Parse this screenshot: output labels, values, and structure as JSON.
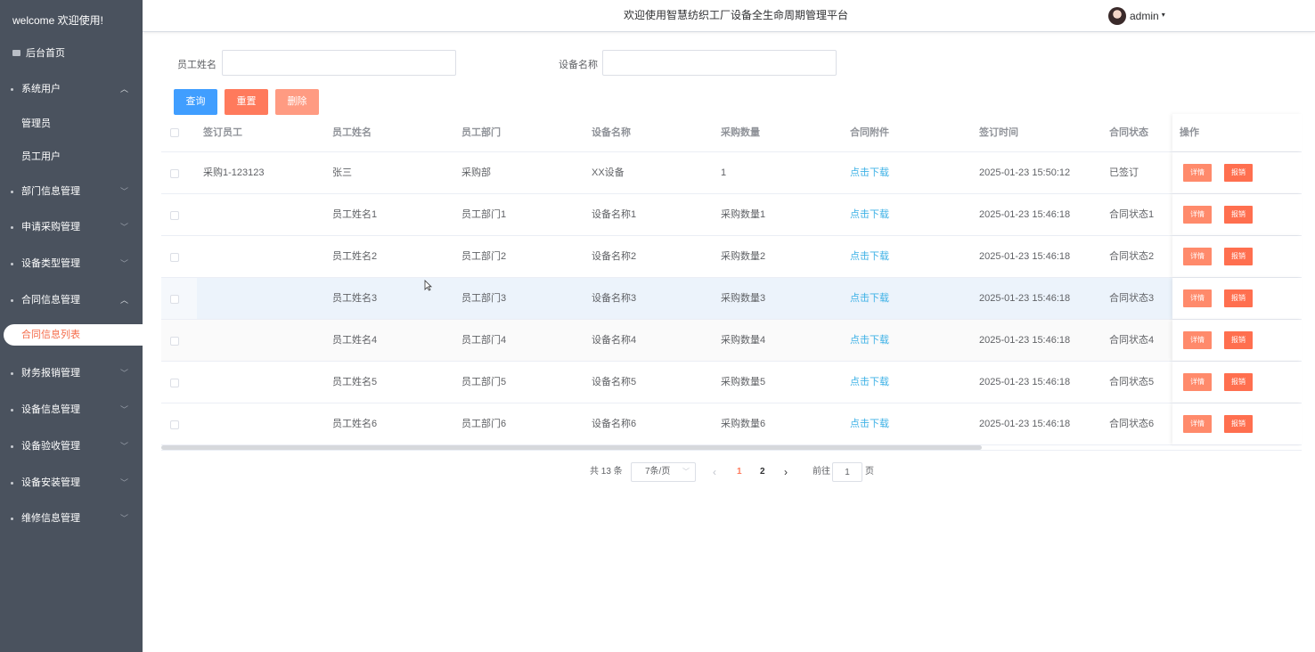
{
  "sidebar": {
    "welcome": "welcome 欢迎使用!",
    "home": "后台首页",
    "system_users": "系统用户",
    "sub_admin": "管理员",
    "sub_staff": "员工用户",
    "dept": "部门信息管理",
    "purchase": "申请采购管理",
    "device_type": "设备类型管理",
    "contract": "合同信息管理",
    "contract_list": "合同信息列表",
    "finance": "财务报销管理",
    "device_info": "设备信息管理",
    "device_accept": "设备验收管理",
    "device_install": "设备安装管理",
    "repair": "维修信息管理"
  },
  "header": {
    "title": "欢迎使用智慧纺织工厂设备全生命周期管理平台",
    "user": "admin"
  },
  "search": {
    "name_label": "员工姓名",
    "name_value": "",
    "device_label": "设备名称",
    "device_value": "",
    "query": "查询",
    "reset": "重置",
    "delete": "删除"
  },
  "colors": {
    "sidebar_bg": "#4a525e",
    "primary": "#409eff",
    "danger": "#ff7a5c",
    "link": "#3db1e6"
  },
  "table": {
    "headers": {
      "signer": "签订员工",
      "name": "员工姓名",
      "dept": "员工部门",
      "device": "设备名称",
      "qty": "采购数量",
      "attach": "合同附件",
      "time": "签订时间",
      "status": "合同状态",
      "ops": "操作"
    },
    "detail_btn": "详情",
    "report_btn": "报销",
    "rows": [
      {
        "signer": "采购1-123123",
        "name": "张三",
        "dept": "采购部",
        "device": "XX设备",
        "qty": "1",
        "attach": "点击下载",
        "time": "2025-01-23 15:50:12",
        "status": "已签订"
      },
      {
        "signer": "",
        "name": "员工姓名1",
        "dept": "员工部门1",
        "device": "设备名称1",
        "qty": "采购数量1",
        "attach": "点击下载",
        "time": "2025-01-23 15:46:18",
        "status": "合同状态1"
      },
      {
        "signer": "",
        "name": "员工姓名2",
        "dept": "员工部门2",
        "device": "设备名称2",
        "qty": "采购数量2",
        "attach": "点击下载",
        "time": "2025-01-23 15:46:18",
        "status": "合同状态2"
      },
      {
        "signer": "",
        "name": "员工姓名3",
        "dept": "员工部门3",
        "device": "设备名称3",
        "qty": "采购数量3",
        "attach": "点击下载",
        "time": "2025-01-23 15:46:18",
        "status": "合同状态3"
      },
      {
        "signer": "",
        "name": "员工姓名4",
        "dept": "员工部门4",
        "device": "设备名称4",
        "qty": "采购数量4",
        "attach": "点击下载",
        "time": "2025-01-23 15:46:18",
        "status": "合同状态4"
      },
      {
        "signer": "",
        "name": "员工姓名5",
        "dept": "员工部门5",
        "device": "设备名称5",
        "qty": "采购数量5",
        "attach": "点击下载",
        "time": "2025-01-23 15:46:18",
        "status": "合同状态5"
      },
      {
        "signer": "",
        "name": "员工姓名6",
        "dept": "员工部门6",
        "device": "设备名称6",
        "qty": "采购数量6",
        "attach": "点击下载",
        "time": "2025-01-23 15:46:18",
        "status": "合同状态6"
      }
    ]
  },
  "pagination": {
    "total": "共 13 条",
    "page_size": "7条/页",
    "prev": "‹",
    "page1": "1",
    "page2": "2",
    "next": "›",
    "goto": "前往",
    "goto_value": "1",
    "page_unit": "页"
  }
}
